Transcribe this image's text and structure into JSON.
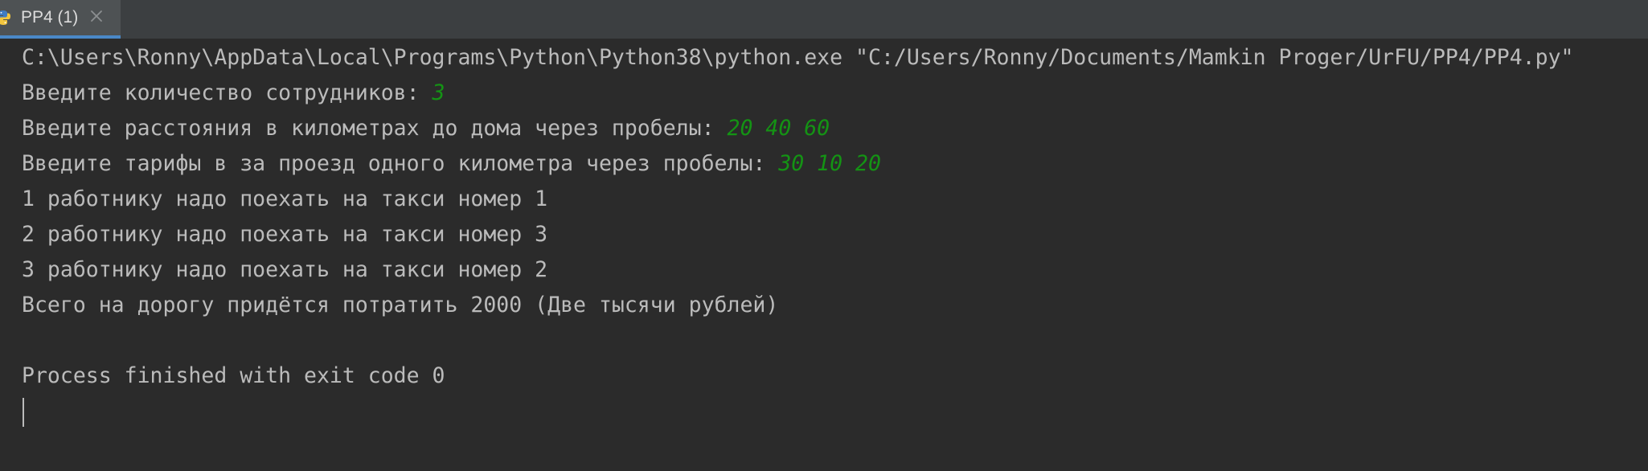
{
  "tab": {
    "label": "PP4 (1)",
    "icon": "python-icon",
    "close_icon": "close-icon"
  },
  "colors": {
    "background": "#2b2b2b",
    "tab_bar": "#3c3f41",
    "active_tab": "#4e5254",
    "tab_underline": "#4a88c7",
    "output_text": "#bbbbbb",
    "user_input": "#149314"
  },
  "console": {
    "command": "C:\\Users\\Ronny\\AppData\\Local\\Programs\\Python\\Python38\\python.exe \"C:/Users/Ronny/Documents/Mamkin Proger/UrFU/PP4/PP4.py\"",
    "prompt1": "Введите количество сотрудников: ",
    "input1": "3",
    "prompt2": "Введите расстояния в километрах до дома через пробелы: ",
    "input2": "20 40 60",
    "prompt3": "Введите тарифы в за проезд одного километра через пробелы: ",
    "input3": "30 10 20",
    "out1": "1 работнику надо поехать на такси номер 1",
    "out2": "2 работнику надо поехать на такси номер 3",
    "out3": "3 работнику надо поехать на такси номер 2",
    "total": "Всего на дорогу придётся потратить 2000 (Две тысячи рублей)",
    "finished": "Process finished with exit code 0"
  }
}
